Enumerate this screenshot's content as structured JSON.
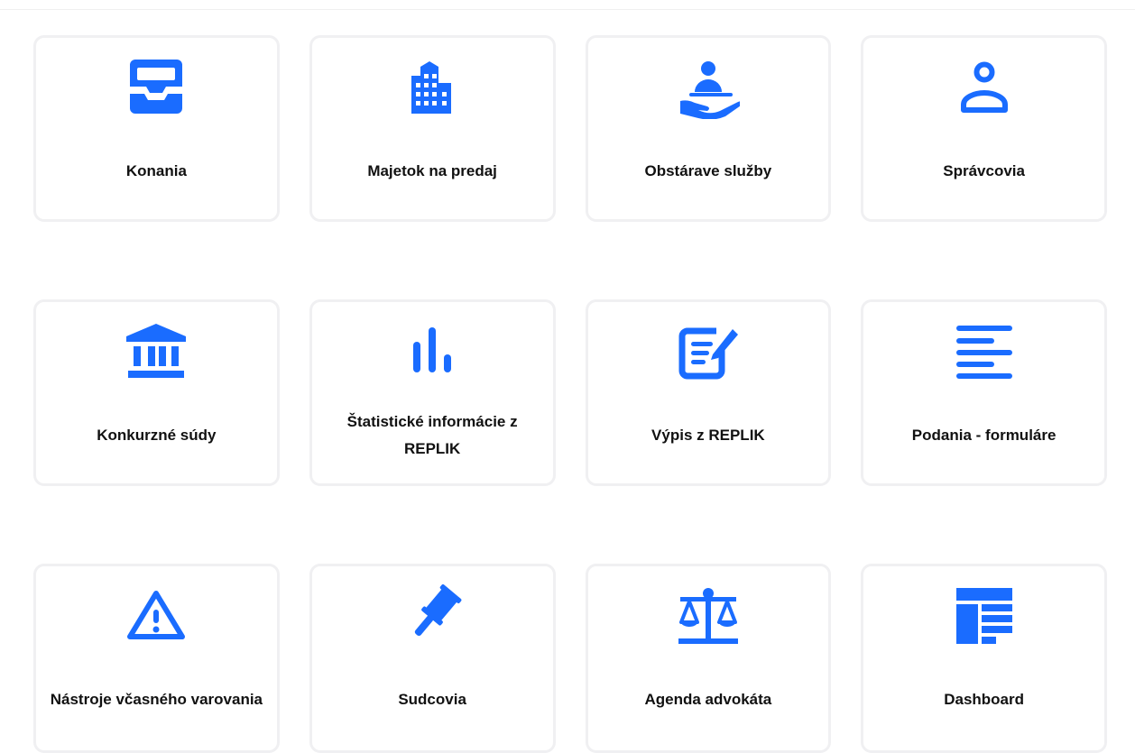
{
  "accent_color": "#1a6cff",
  "tiles": [
    {
      "label": "Konania",
      "icon": "inbox-tray-icon"
    },
    {
      "label": "Majetok na predaj",
      "icon": "buildings-icon"
    },
    {
      "label": "Obstárave služby",
      "icon": "service-hand-icon"
    },
    {
      "label": "Správcovia",
      "icon": "person-icon"
    },
    {
      "label": "Konkurzné súdy",
      "icon": "courthouse-icon"
    },
    {
      "label": "Štatistické informácie z REPLIK",
      "icon": "bar-chart-icon"
    },
    {
      "label": "Výpis z REPLIK",
      "icon": "document-edit-icon"
    },
    {
      "label": "Podania - formuláre",
      "icon": "text-lines-icon"
    },
    {
      "label": "Nástroje včasného varovania",
      "icon": "warning-icon"
    },
    {
      "label": "Sudcovia",
      "icon": "gavel-icon"
    },
    {
      "label": "Agenda advokáta",
      "icon": "scales-icon"
    },
    {
      "label": "Dashboard",
      "icon": "dashboard-icon"
    }
  ]
}
